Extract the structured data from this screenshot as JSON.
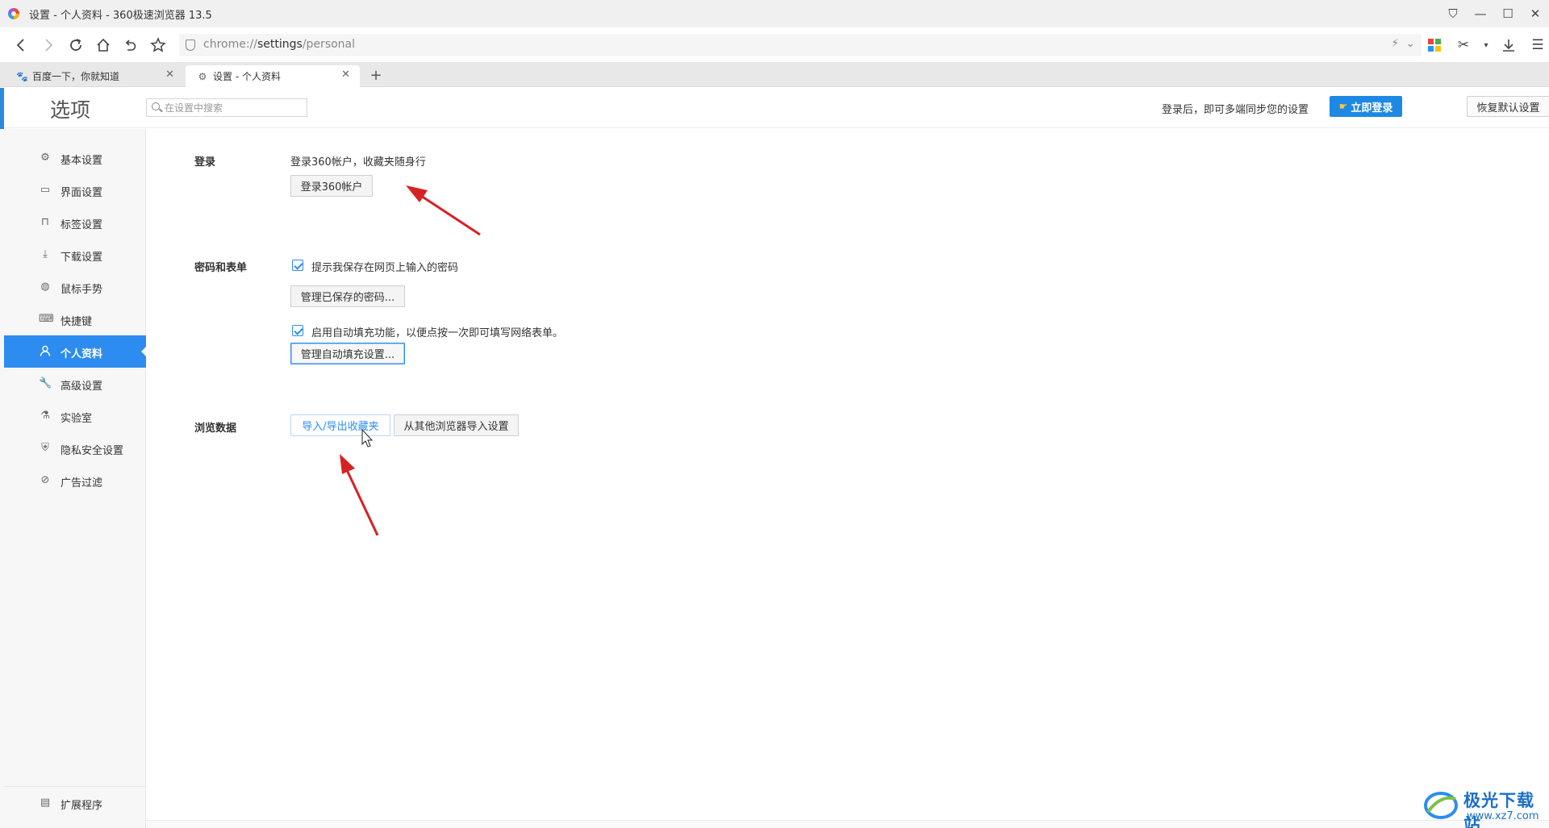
{
  "window": {
    "title": "设置 - 个人资料 - 360极速浏览器 13.5",
    "controls": [
      "⛉",
      "—",
      "☐",
      "✕"
    ]
  },
  "address": {
    "url_prefix": "chrome://",
    "url_path": "settings",
    "url_suffix": "/personal"
  },
  "tabs": [
    {
      "title": "百度一下，你就知道",
      "close": "✕",
      "icon": "baidu-paw-icon"
    },
    {
      "title": "设置 - 个人资料",
      "close": "✕",
      "icon": "gear-icon"
    }
  ],
  "new_tab": "+",
  "header": {
    "title": "选项",
    "search_placeholder": "在设置中搜索",
    "sync_text": "登录后，即可多端同步您的设置",
    "login_button": "立即登录",
    "reset_button": "恢复默认设置"
  },
  "sidebar": {
    "items": [
      {
        "label": "基本设置",
        "icon": "gear-outline-icon",
        "active": false
      },
      {
        "label": "界面设置",
        "icon": "window-icon",
        "active": false
      },
      {
        "label": "标签设置",
        "icon": "tab-icon",
        "active": false
      },
      {
        "label": "下载设置",
        "icon": "download-icon",
        "active": false
      },
      {
        "label": "鼠标手势",
        "icon": "mouse-icon",
        "active": false
      },
      {
        "label": "快捷键",
        "icon": "keyboard-icon",
        "active": false
      },
      {
        "label": "个人资料",
        "icon": "user-icon",
        "active": true
      },
      {
        "label": "高级设置",
        "icon": "wrench-icon",
        "active": false
      },
      {
        "label": "实验室",
        "icon": "flask-icon",
        "active": false
      },
      {
        "label": "隐私安全设置",
        "icon": "shield-icon",
        "active": false
      },
      {
        "label": "广告过滤",
        "icon": "block-icon",
        "active": false
      }
    ],
    "extensions": "扩展程序"
  },
  "sections": {
    "login": {
      "label": "登录",
      "desc": "登录360帐户，收藏夹随身行",
      "button": "登录360帐户"
    },
    "password": {
      "label": "密码和表单",
      "save_password_checkbox": "提示我保存在网页上输入的密码",
      "manage_passwords_button": "管理已保存的密码...",
      "autofill_checkbox": "启用自动填充功能，以便点按一次即可填写网络表单。",
      "manage_autofill_button": "管理自动填充设置..."
    },
    "browse": {
      "label": "浏览数据",
      "import_export_button": "导入/导出收藏夹",
      "import_other_button": "从其他浏览器导入设置"
    }
  },
  "watermark": {
    "name": "极光下载站",
    "url": "www.xz7.com"
  },
  "colors": {
    "accent": "#2d8cf0",
    "arrow": "#d62222",
    "login_button": "#1e88e5"
  }
}
